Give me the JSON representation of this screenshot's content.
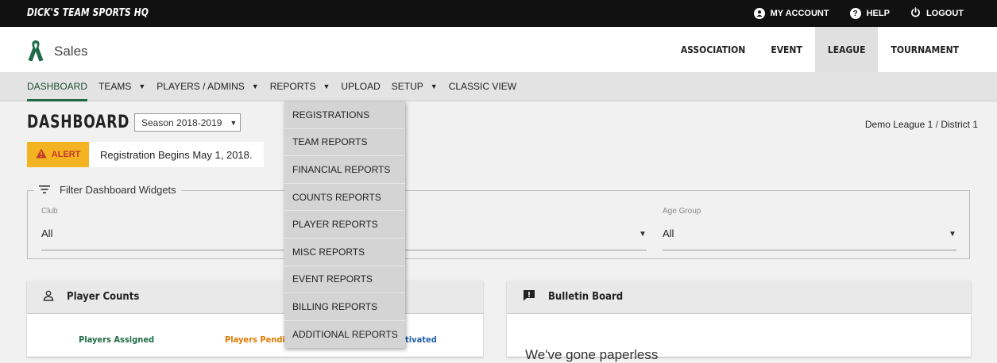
{
  "topbar": {
    "brand": "DICK'S TEAM SPORTS HQ",
    "links": [
      {
        "label": "MY ACCOUNT",
        "icon": "account-icon"
      },
      {
        "label": "HELP",
        "icon": "help-icon"
      },
      {
        "label": "LOGOUT",
        "icon": "power-icon"
      }
    ]
  },
  "header": {
    "app_title": "Sales",
    "nav": [
      "ASSOCIATION",
      "EVENT",
      "LEAGUE",
      "TOURNAMENT"
    ],
    "active_nav": "LEAGUE"
  },
  "subnav": {
    "items": [
      "DASHBOARD",
      "TEAMS",
      "PLAYERS / ADMINS",
      "REPORTS",
      "UPLOAD",
      "SETUP",
      "CLASSIC VIEW"
    ]
  },
  "page": {
    "title": "DASHBOARD",
    "season": "Season 2018-2019",
    "breadcrumb_league": "Demo League 1",
    "breadcrumb_sep": "/",
    "breadcrumb_district": "District 1"
  },
  "alert": {
    "tag": "ALERT",
    "message": "Registration Begins May 1, 2018."
  },
  "filter": {
    "legend": "Filter Dashboard Widgets",
    "club_label": "Club",
    "club_value": "All",
    "age_label": "Age Group",
    "age_value": "All"
  },
  "player_counts": {
    "title": "Player Counts",
    "assigned": "Players Assigned",
    "pending": "Players Pending",
    "activated_fragment": "tivated"
  },
  "bulletin": {
    "title": "Bulletin Board",
    "text": "We've gone paperless"
  },
  "reports_menu": [
    "REGISTRATIONS",
    "TEAM REPORTS",
    "FINANCIAL REPORTS",
    "COUNTS REPORTS",
    "PLAYER REPORTS",
    "MISC REPORTS",
    "EVENT REPORTS",
    "BILLING REPORTS",
    "ADDITIONAL REPORTS"
  ],
  "colors": {
    "accent_green": "#1f6b47",
    "alert_yellow": "#f4b321",
    "pending_orange": "#e07b00",
    "activated_blue": "#1f5fa8"
  }
}
